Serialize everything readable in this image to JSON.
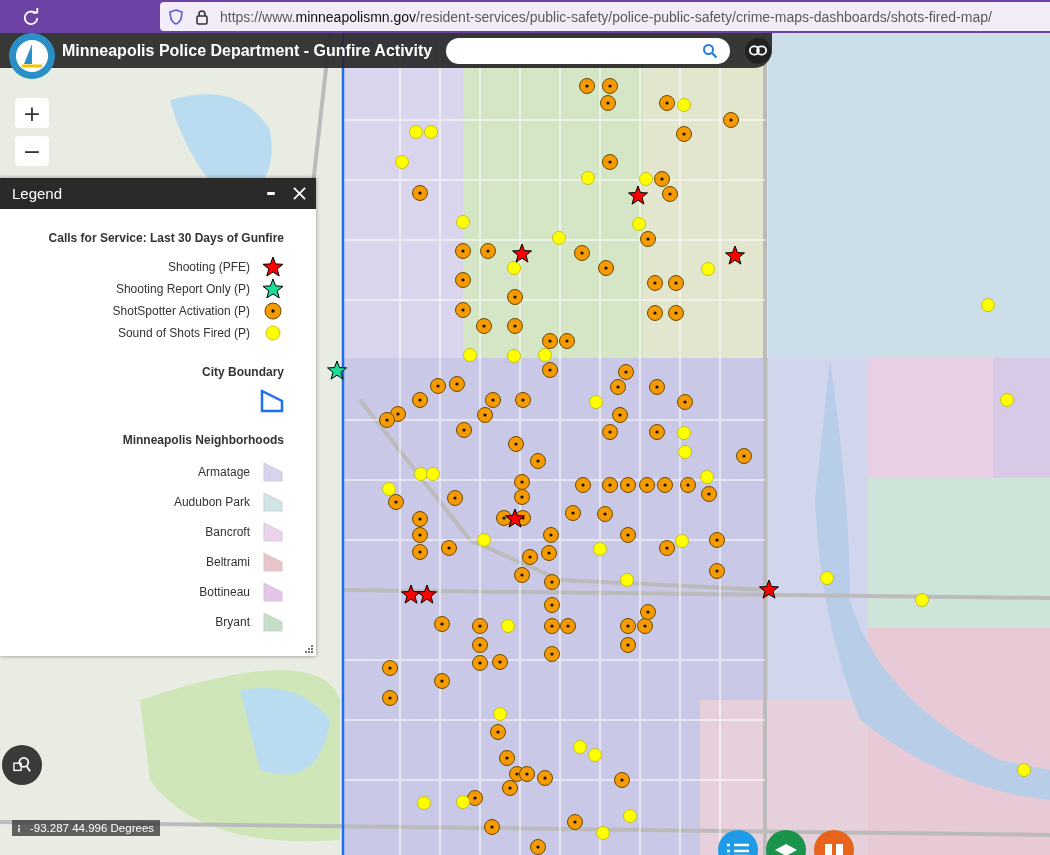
{
  "browser": {
    "url": "https://www.**minneapolismn.gov**/resident-services/public-safety/police-public-safety/crime-maps-dashboards/shots-fired-map/"
  },
  "header": {
    "title": "Minneapolis Police Department - Gunfire Activity"
  },
  "zoom": [
    "+",
    "−"
  ],
  "legend": {
    "title": "Legend",
    "sections": [
      {
        "heading": "Calls for Service: Last 30 Days of Gunfire",
        "items": [
          {
            "label": "Shooting (PFE)",
            "kind": "star",
            "color": "#ff0000"
          },
          {
            "label": "Shooting Report Only (P)",
            "kind": "star",
            "color": "#1ddc9a"
          },
          {
            "label": "ShotSpotter Activation (P)",
            "kind": "dot",
            "color": "#f59a00"
          },
          {
            "label": "Sound of Shots Fired (P)",
            "kind": "circle",
            "color": "#ffff00"
          }
        ]
      },
      {
        "heading": "City Boundary",
        "items": [
          {
            "kind": "boundary",
            "color": "#1e6ff0"
          }
        ]
      },
      {
        "heading": "Minneapolis Neighborhoods",
        "items": [
          {
            "label": "Armatage",
            "kind": "polygon",
            "color": "#d6d3ec"
          },
          {
            "label": "Audubon Park",
            "kind": "polygon",
            "color": "#cfe6e8"
          },
          {
            "label": "Bancroft",
            "kind": "polygon",
            "color": "#ecd3ec"
          },
          {
            "label": "Beltrami",
            "kind": "polygon",
            "color": "#e8c4c8"
          },
          {
            "label": "Bottineau",
            "kind": "polygon",
            "color": "#e6c4e8"
          },
          {
            "label": "Bryant",
            "kind": "polygon",
            "color": "#c6dec6"
          }
        ]
      }
    ]
  },
  "coordinates": "-93.287 44.996 Degrees"
}
